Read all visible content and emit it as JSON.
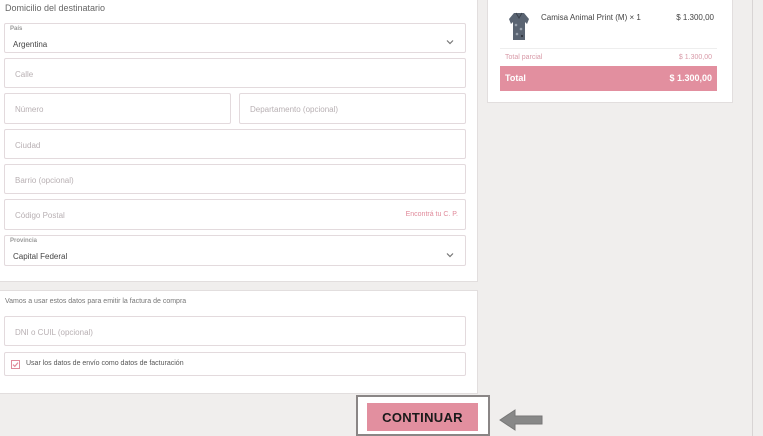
{
  "shipping": {
    "section_title": "Domicilio del destinatario",
    "country": {
      "label": "País",
      "value": "Argentina"
    },
    "street_placeholder": "Calle",
    "number_placeholder": "Número",
    "apartment_placeholder": "Departamento (opcional)",
    "city_placeholder": "Ciudad",
    "neighborhood_placeholder": "Barrio (opcional)",
    "postal_placeholder": "Código Postal",
    "postal_link": "Encontrá tu C. P.",
    "province": {
      "label": "Provincia",
      "value": "Capital Federal"
    }
  },
  "billing": {
    "note": "Vamos a usar estos datos para emitir la factura de compra",
    "dni_placeholder": "DNI o CUIL (opcional)",
    "same_as_shipping_label": "Usar los datos de envío como datos de facturación",
    "same_as_shipping_checked": true
  },
  "order_summary": {
    "item_name": "Camisa Animal Print (M) × 1",
    "item_price": "$ 1.300,00",
    "subtotal_label": "Total parcial",
    "subtotal_amount": "$ 1.300,00",
    "total_label": "Total",
    "total_amount": "$ 1.300,00"
  },
  "continue_label": "CONTINUAR",
  "colors": {
    "accent": "#e28f9f",
    "page_background": "#f0eeed"
  }
}
